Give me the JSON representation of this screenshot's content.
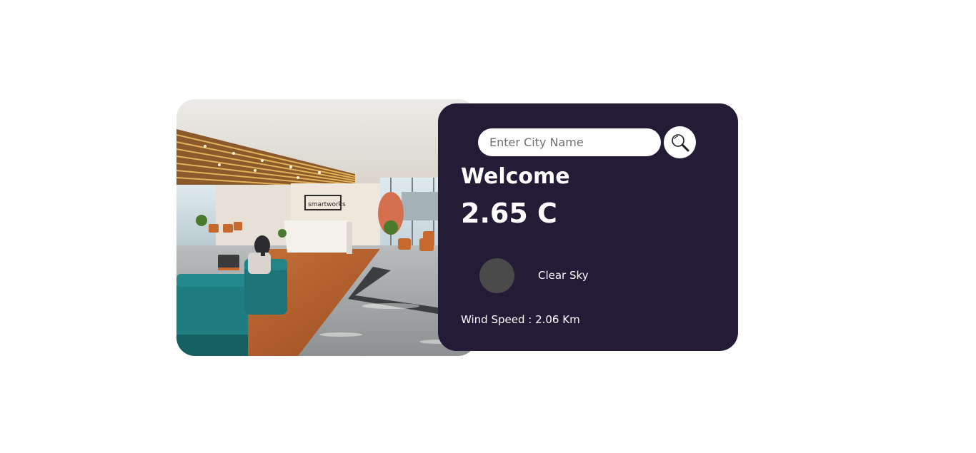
{
  "theme": {
    "card_background": "#241b37",
    "text_color": "#ffffff",
    "icon_placeholder_color": "#4a4a4a"
  },
  "hero_image": {
    "sign_text": "smartworks"
  },
  "search": {
    "placeholder": "Enter City Name",
    "value": "",
    "button_icon": "magnifier-icon"
  },
  "weather": {
    "greeting": "Welcome",
    "temperature": "2.65 C",
    "icon": "weather-icon",
    "condition": "Clear Sky",
    "wind_speed": "Wind Speed : 2.06 Km"
  }
}
